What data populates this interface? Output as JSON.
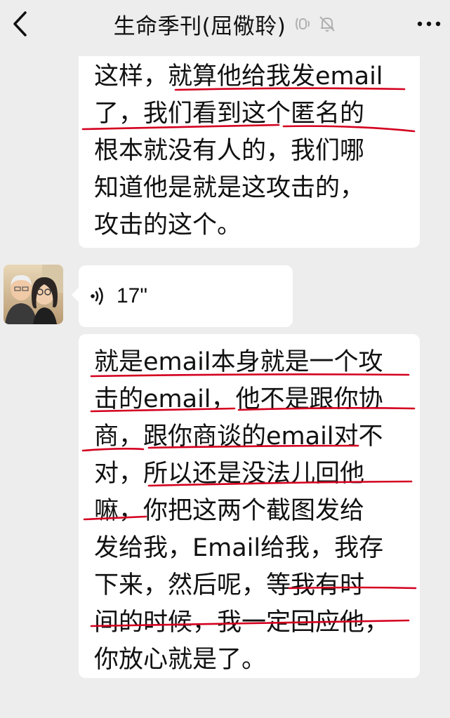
{
  "header": {
    "title": "生命季刊(屈儆聆)",
    "icons": [
      "back-icon",
      "ear-icon",
      "mute-bell-icon",
      "more-icon"
    ]
  },
  "messages": [
    {
      "type": "text",
      "lines": [
        "这样，就算他给我发email",
        "了，我们看到这个匿名的",
        "根本就没有人的，我们哪",
        "知道他是就是这攻击的，",
        "攻击的这个。"
      ]
    },
    {
      "type": "voice",
      "duration": "17\""
    },
    {
      "type": "text",
      "lines": [
        "就是email本身就是一个攻",
        "击的email，他不是跟你协",
        "商，跟你商谈的email对不",
        "对，所以还是没法儿回他",
        "嘛，你把这两个截图发给",
        "发给我，Email给我，我存",
        "下来，然后呢，等我有时",
        "间的时候，我一定回应他，",
        "你放心就是了。"
      ]
    }
  ],
  "colors": {
    "background": "#ededed",
    "bubble": "#ffffff",
    "annotation": "#d4001f"
  }
}
